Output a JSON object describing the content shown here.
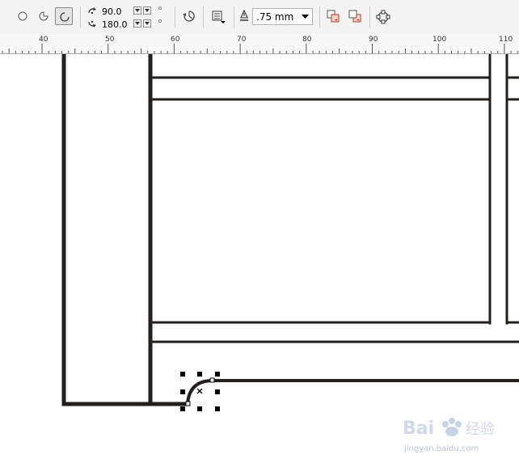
{
  "toolbar": {
    "start_angle": "90.0",
    "end_angle": "180.0",
    "outline_width": ".75 mm",
    "tools": [
      "ellipse-tool",
      "pie-tool",
      "arc-tool"
    ],
    "active_tool": "arc-tool"
  },
  "ruler": {
    "labels": [
      "40",
      "50",
      "60",
      "70",
      "80",
      "90",
      "100",
      "110"
    ]
  },
  "watermark": {
    "brand": "Baidu 经验",
    "url": "jingyan.baidu.com"
  }
}
